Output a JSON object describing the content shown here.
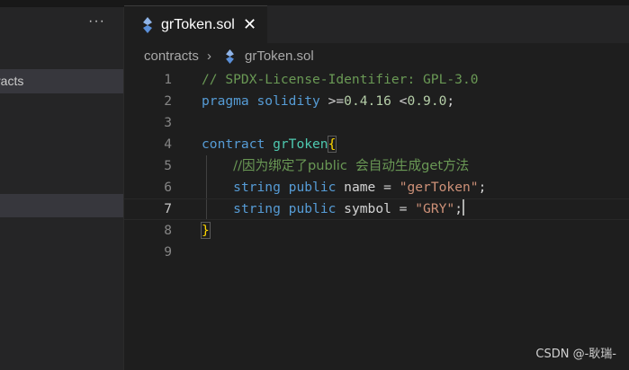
{
  "sidebar": {
    "more_label": "···",
    "folder_label": "racts"
  },
  "tab": {
    "label": "grToken.sol",
    "close_label": "✕",
    "icon": "solidity-icon",
    "icon_color": "#8fb4e8"
  },
  "breadcrumb": {
    "folder": "contracts",
    "separator": "›",
    "file": "grToken.sol"
  },
  "editor": {
    "active_line": 7,
    "line_numbers": [
      "1",
      "2",
      "3",
      "4",
      "5",
      "6",
      "7",
      "8",
      "9"
    ],
    "lines": {
      "l1_comment": "// SPDX-License-Identifier: GPL-3.0",
      "l2_pragma": "pragma",
      "l2_solidity": "solidity",
      "l2_ge": " >=",
      "l2_v1": "0.4.16",
      "l2_lt": " <",
      "l2_v2": "0.9.0",
      "l2_semi": ";",
      "l4_contract": "contract",
      "l4_name": "grToken",
      "l4_brace": "{",
      "l5_comment": "//因为绑定了public  会自动生成get方法",
      "l6_type": "string",
      "l6_vis": "public",
      "l6_rest": " name = ",
      "l6_str": "\"gerToken\"",
      "l6_semi": ";",
      "l7_type": "string",
      "l7_vis": "public",
      "l7_rest": " symbol = ",
      "l7_str": "\"GRY\"",
      "l7_semi": ";",
      "l8_brace": "}"
    }
  },
  "watermark": "CSDN @-耿瑞-"
}
